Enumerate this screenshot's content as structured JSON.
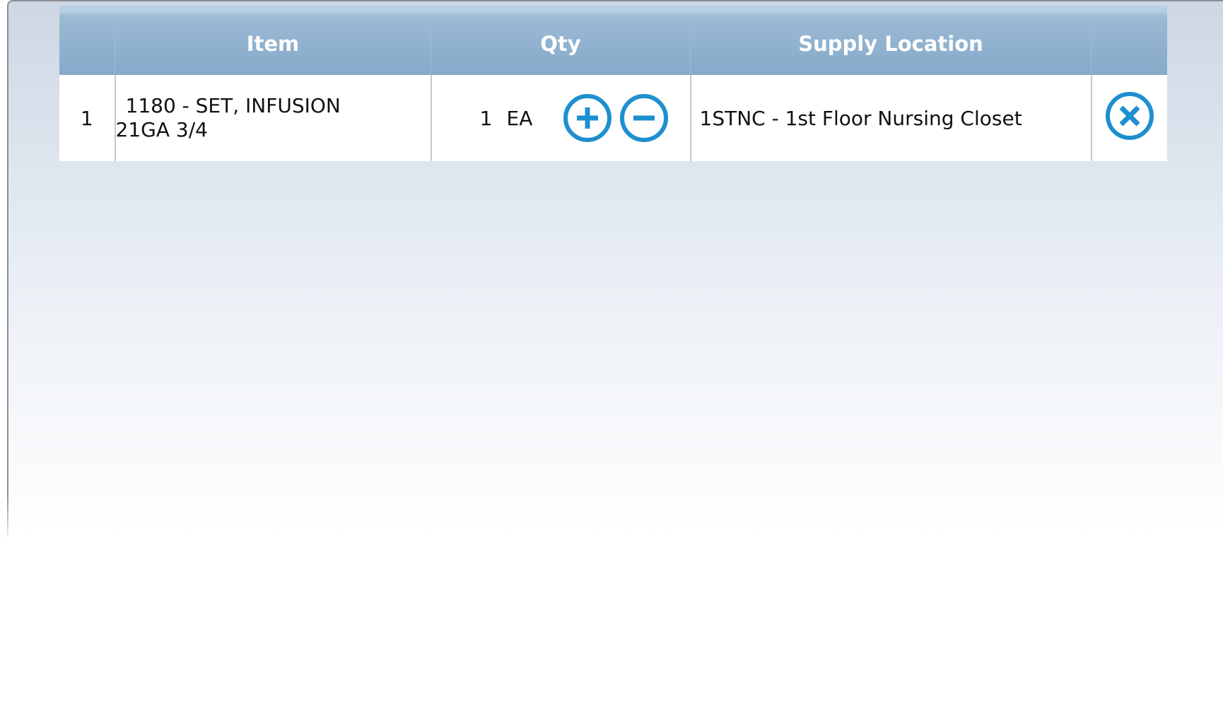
{
  "colors": {
    "header_start": "#a9c4db",
    "header_end": "#86aaca",
    "icon_blue": "#1e8fcf",
    "background_top": "#cdd7e4"
  },
  "table": {
    "headers": {
      "number": "",
      "item": "Item",
      "qty": "Qty",
      "supply_location": "Supply Location",
      "action": ""
    },
    "rows": [
      {
        "number": "1",
        "item_line1": "1180 - SET, INFUSION",
        "item_line2": "21GA 3/4",
        "qty": "1",
        "unit": "EA",
        "increment_icon": "plus-circle-icon",
        "decrement_icon": "minus-circle-icon",
        "supply_location": "1STNC - 1st Floor Nursing Closet",
        "remove_icon": "close-circle-icon"
      }
    ]
  }
}
